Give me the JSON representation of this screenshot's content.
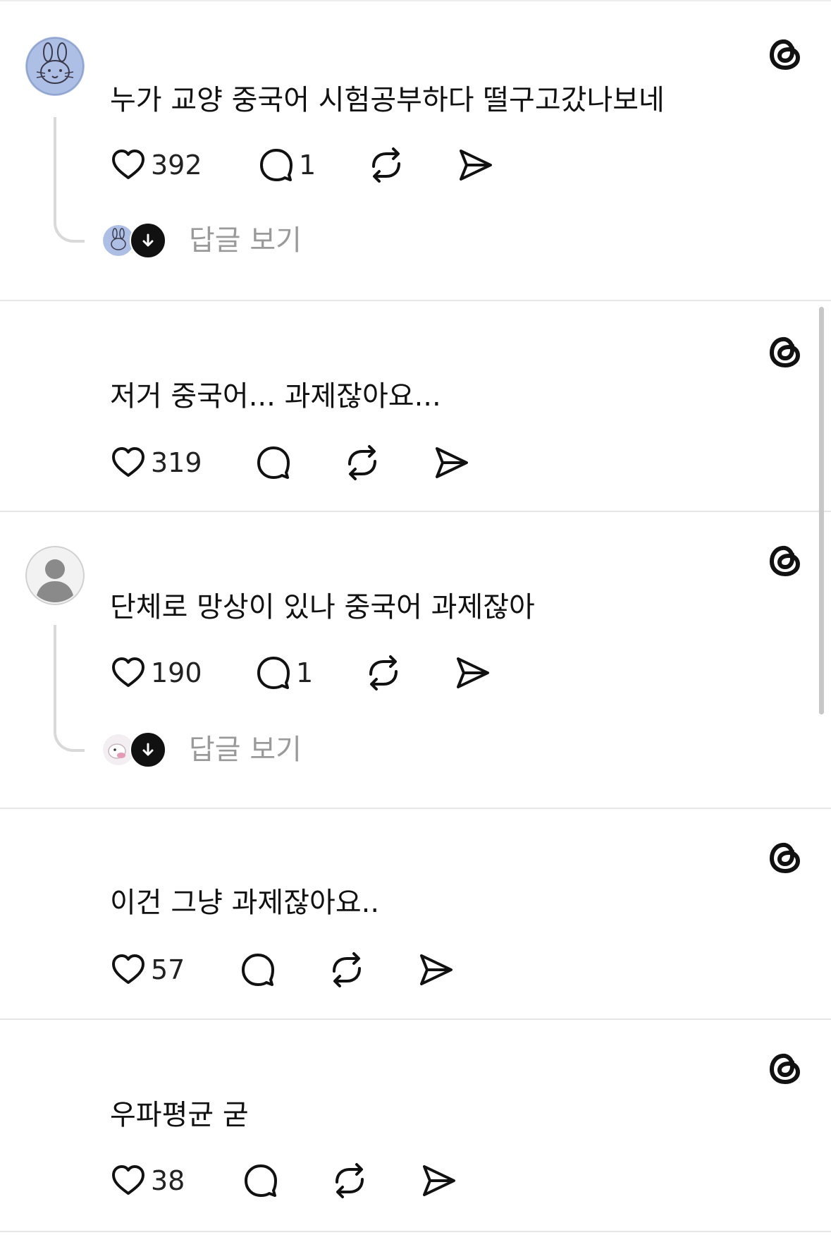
{
  "posts": [
    {
      "text": "누가 교양 중국어 시험공부하다 떨구고갔나보네",
      "likes": "392",
      "comments": "1",
      "has_avatar": true,
      "view_replies_label": "답글 보기"
    },
    {
      "text": "저거 중국어... 과제잖아요...",
      "likes": "319",
      "comments": "",
      "has_avatar": false
    },
    {
      "text": "단체로 망상이 있나 중국어 과제잖아",
      "likes": "190",
      "comments": "1",
      "has_avatar": true,
      "view_replies_label": "답글 보기"
    },
    {
      "text": "이건 그냥 과제잖아요..",
      "likes": "57",
      "comments": "",
      "has_avatar": false
    },
    {
      "text": "우파평균 굳",
      "likes": "38",
      "comments": "",
      "has_avatar": false
    }
  ],
  "icons": {
    "like": "heart-icon",
    "comment": "comment-bubble-icon",
    "repost": "repost-icon",
    "share": "send-icon",
    "brand": "threads-logo-icon",
    "reply_toggle": "arrow-down-icon"
  },
  "colors": {
    "text": "#111111",
    "muted": "#9a9a9a",
    "divider": "#e6e6e6",
    "thread_line": "#d9d9d9"
  }
}
